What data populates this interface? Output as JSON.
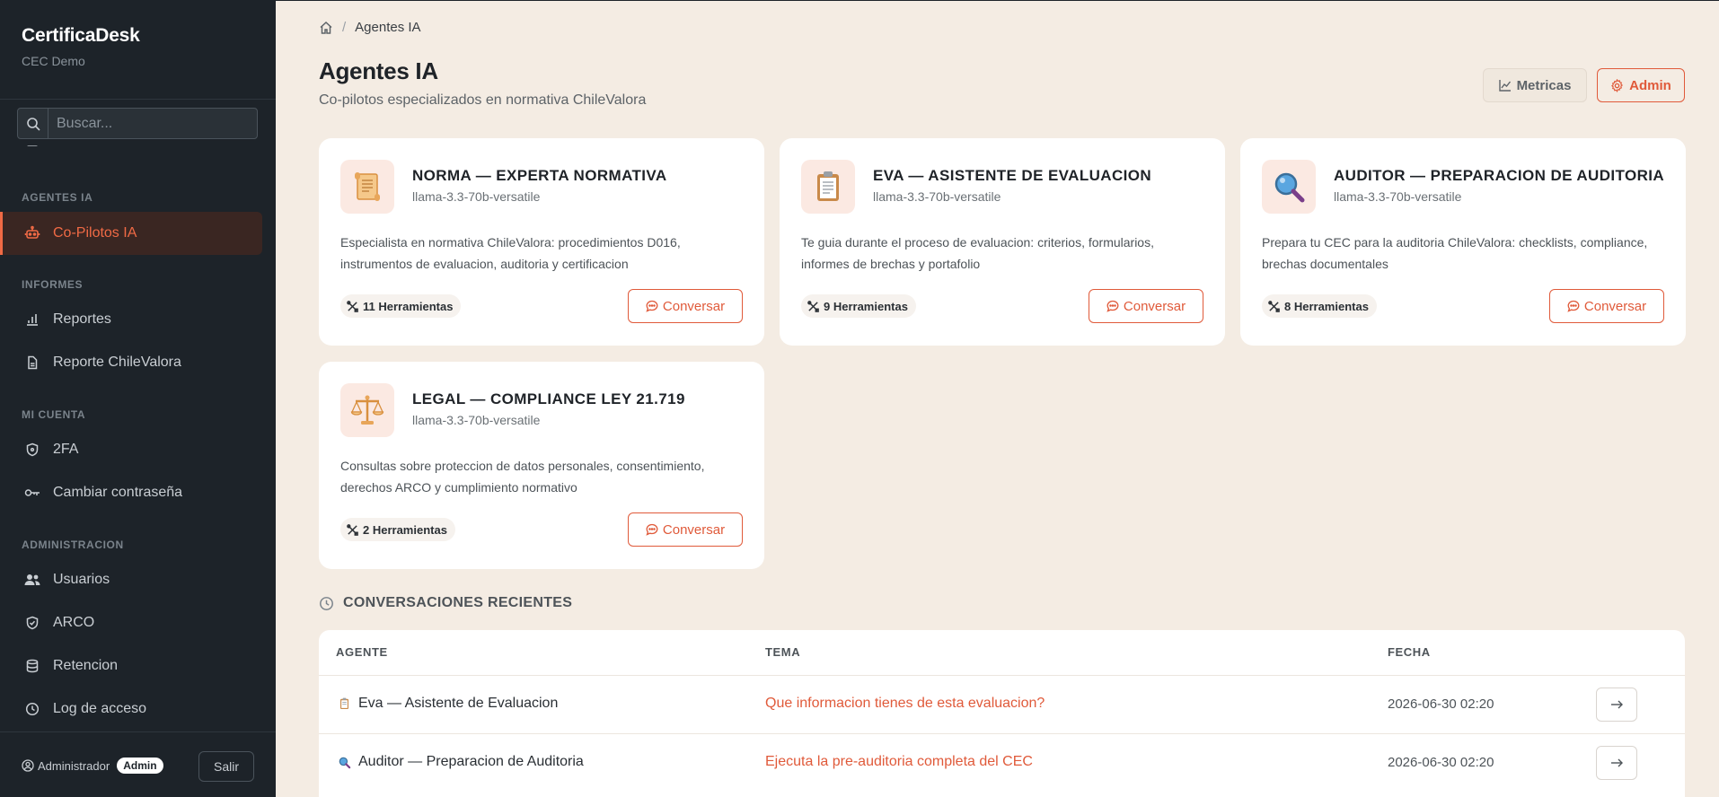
{
  "sidebar": {
    "brand": "CertificaDesk",
    "org": "CEC Demo",
    "search_placeholder": "Buscar...",
    "sections": [
      {
        "label": "AGENTES IA"
      },
      {
        "label": "INFORMES"
      },
      {
        "label": "MI CUENTA"
      },
      {
        "label": "ADMINISTRACION"
      }
    ],
    "items": [
      {
        "label": "Co-Pilotos IA",
        "icon": "robot-icon",
        "active": true
      },
      {
        "label": "Reportes",
        "icon": "bar-chart-icon"
      },
      {
        "label": "Reporte ChileValora",
        "icon": "file-icon"
      },
      {
        "label": "2FA",
        "icon": "shield-icon"
      },
      {
        "label": "Cambiar contraseña",
        "icon": "key-icon"
      },
      {
        "label": "Usuarios",
        "icon": "users-icon"
      },
      {
        "label": "ARCO",
        "icon": "shield-check-icon"
      },
      {
        "label": "Retencion",
        "icon": "database-icon"
      },
      {
        "label": "Log de acceso",
        "icon": "clock-icon"
      }
    ],
    "user": {
      "name": "Administrador",
      "role": "Admin"
    },
    "logout": "Salir"
  },
  "breadcrumb": {
    "current": "Agentes IA"
  },
  "header": {
    "title": "Agentes IA",
    "subtitle": "Co-pilotos especializados en normativa ChileValora",
    "metricas_label": "Metricas",
    "admin_label": "Admin"
  },
  "agents": [
    {
      "icon": "scroll-icon",
      "name": "NORMA — EXPERTA NORMATIVA",
      "model": "llama-3.3-70b-versatile",
      "description": "Especialista en normativa ChileValora: procedimientos D016, instrumentos de evaluacion, auditoria y certificacion",
      "tools": "11 Herramientas",
      "cta": "Conversar"
    },
    {
      "icon": "clipboard-icon",
      "name": "EVA — ASISTENTE DE EVALUACION",
      "model": "llama-3.3-70b-versatile",
      "description": "Te guia durante el proceso de evaluacion: criterios, formularios, informes de brechas y portafolio",
      "tools": "9 Herramientas",
      "cta": "Conversar"
    },
    {
      "icon": "magnifier-icon",
      "name": "AUDITOR — PREPARACION DE AUDITORIA",
      "model": "llama-3.3-70b-versatile",
      "description": "Prepara tu CEC para la auditoria ChileValora: checklists, compliance, brechas documentales",
      "tools": "8 Herramientas",
      "cta": "Conversar"
    },
    {
      "icon": "scales-icon",
      "name": "LEGAL — COMPLIANCE LEY 21.719",
      "model": "llama-3.3-70b-versatile",
      "description": "Consultas sobre proteccion de datos personales, consentimiento, derechos ARCO y cumplimiento normativo",
      "tools": "2 Herramientas",
      "cta": "Conversar"
    }
  ],
  "recent": {
    "title": "CONVERSACIONES RECIENTES",
    "columns": [
      "AGENTE",
      "TEMA",
      "FECHA"
    ],
    "rows": [
      {
        "agent_icon": "clipboard-icon",
        "agent": "Eva — Asistente de Evaluacion",
        "topic": "Que informacion tienes de esta evaluacion?",
        "date": "2026-06-30 02:20"
      },
      {
        "agent_icon": "magnifier-icon",
        "agent": "Auditor — Preparacion de Auditoria",
        "topic": "Ejecuta la pre-auditoria completa del CEC",
        "date": "2026-06-30 02:20"
      }
    ]
  },
  "colors": {
    "accent": "#e05a3a",
    "sidebar_bg": "#1d2329",
    "page_bg": "#f4ece3"
  }
}
